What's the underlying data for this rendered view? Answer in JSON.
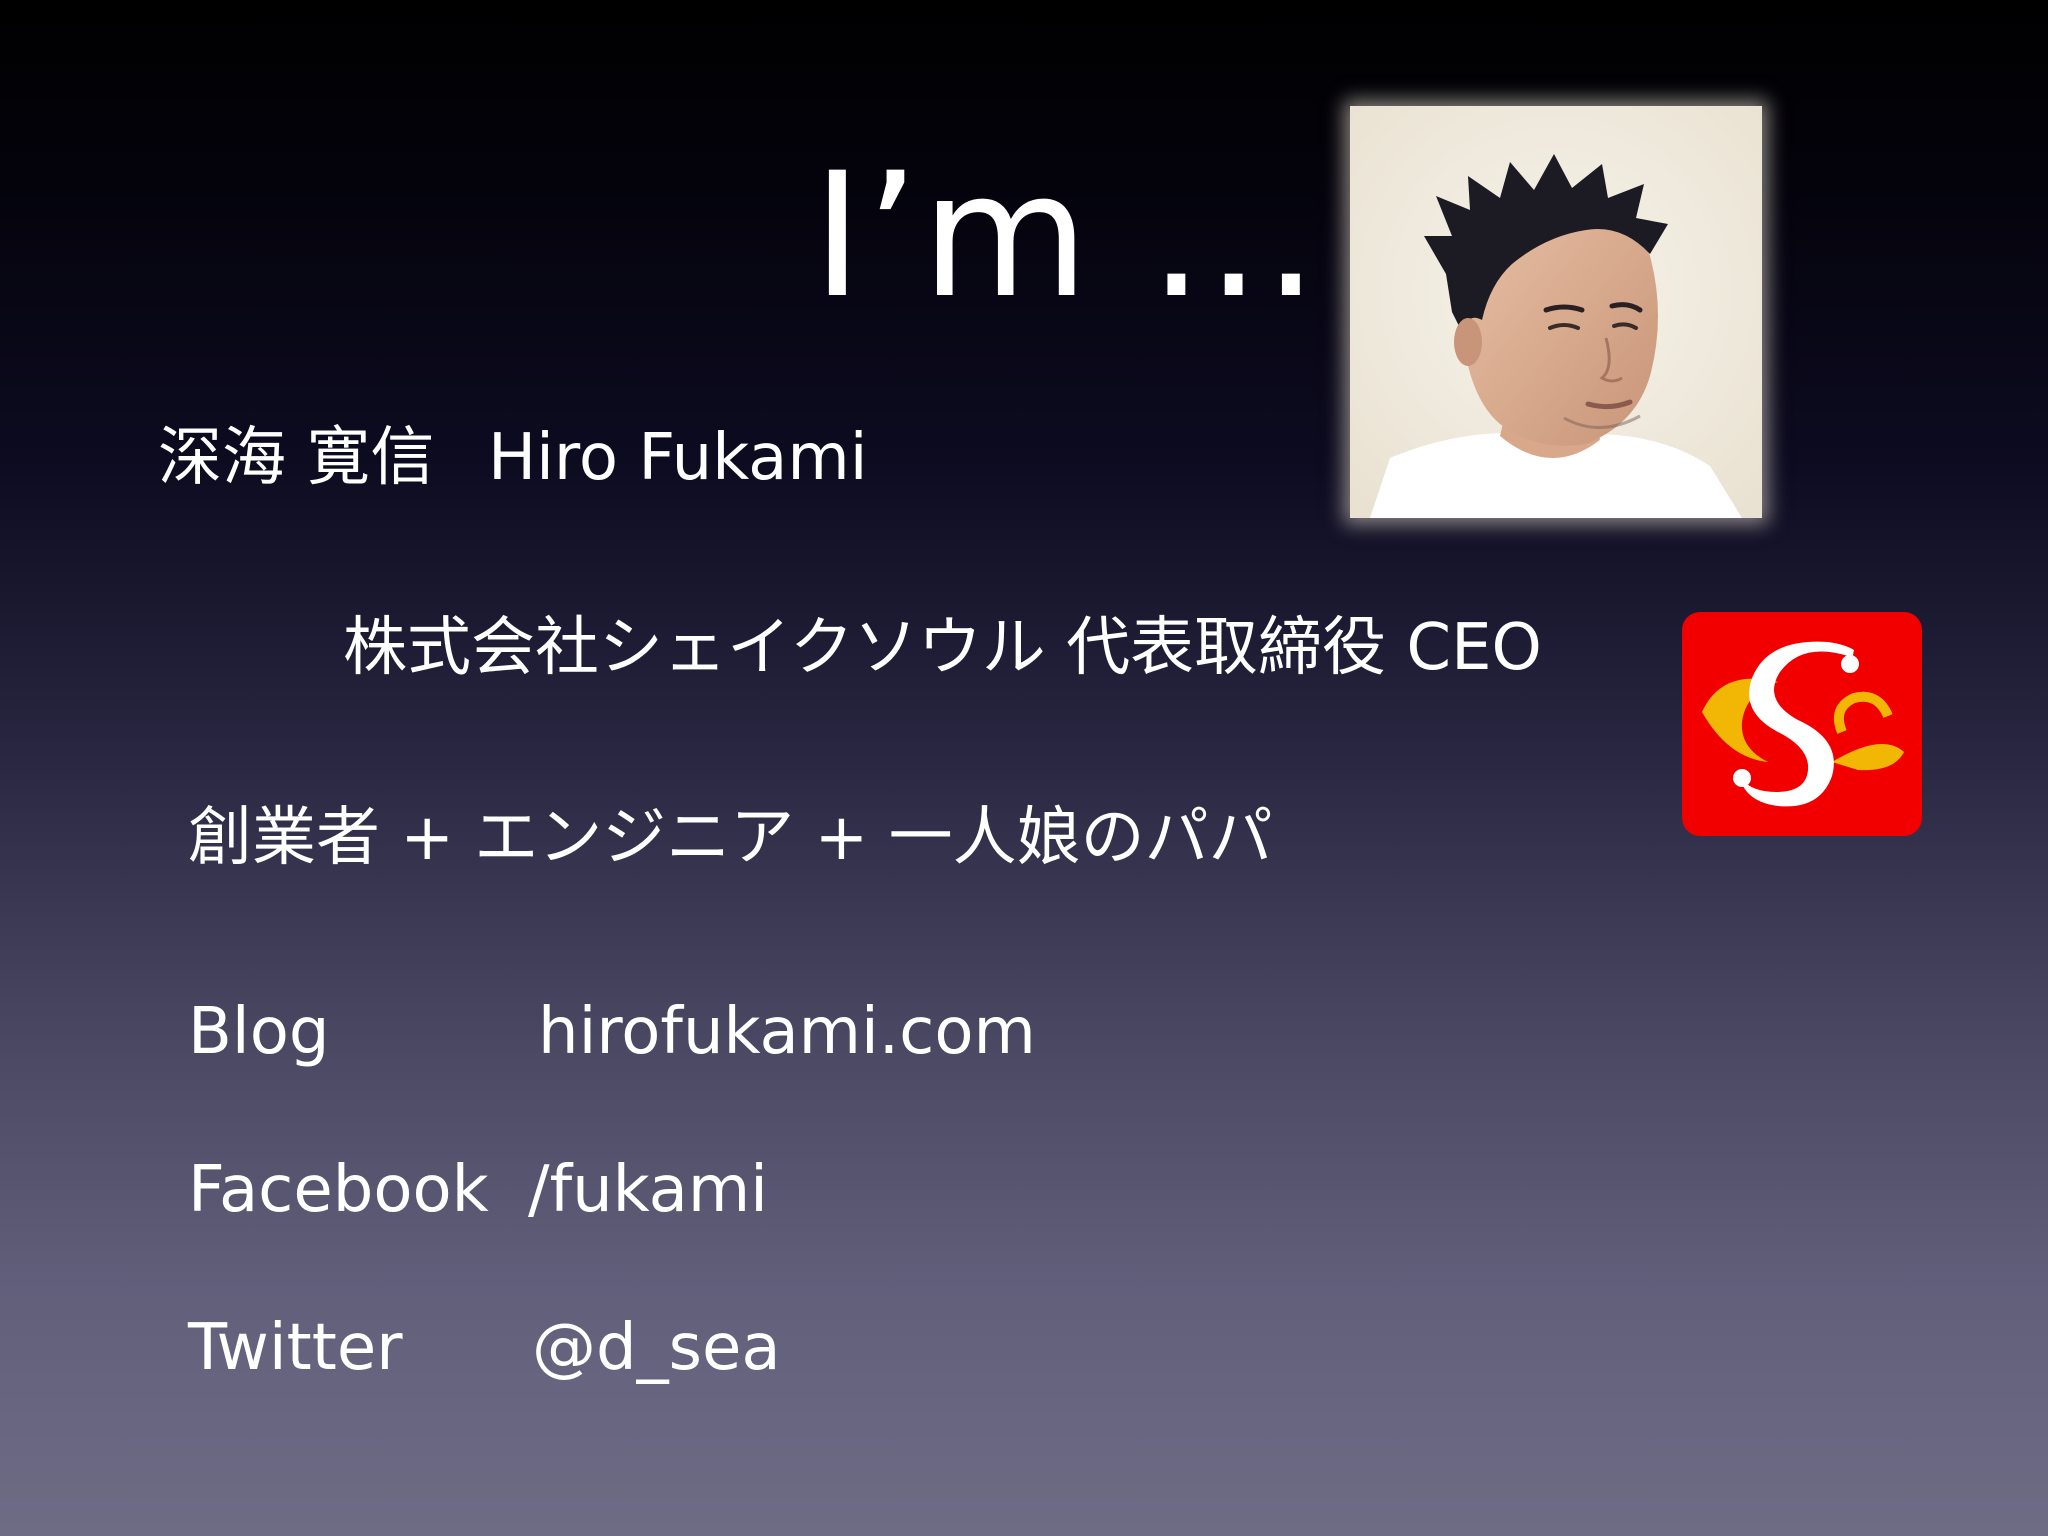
{
  "slide": {
    "title": "I’m …",
    "name_jp": "深海 寛信",
    "name_en": "Hiro Fukami",
    "company": "株式会社シェイクソウル 代表取締役 CEO",
    "roles": "創業者 + エンジニア + 一人娘のパパ",
    "links": [
      {
        "label": "Blog",
        "value": "hirofukami.com"
      },
      {
        "label": "Facebook",
        "value": "/fukami"
      },
      {
        "label": "Twitter",
        "value": "@d_sea"
      }
    ]
  },
  "colors": {
    "background_top": "#000000",
    "background_bottom": "#6e6c85",
    "text": "#ffffff",
    "logo_red": "#f20000",
    "logo_gold": "#f2b705"
  },
  "images": {
    "profile_photo": "profile-photo",
    "company_logo": "shakesoul-logo-icon"
  }
}
